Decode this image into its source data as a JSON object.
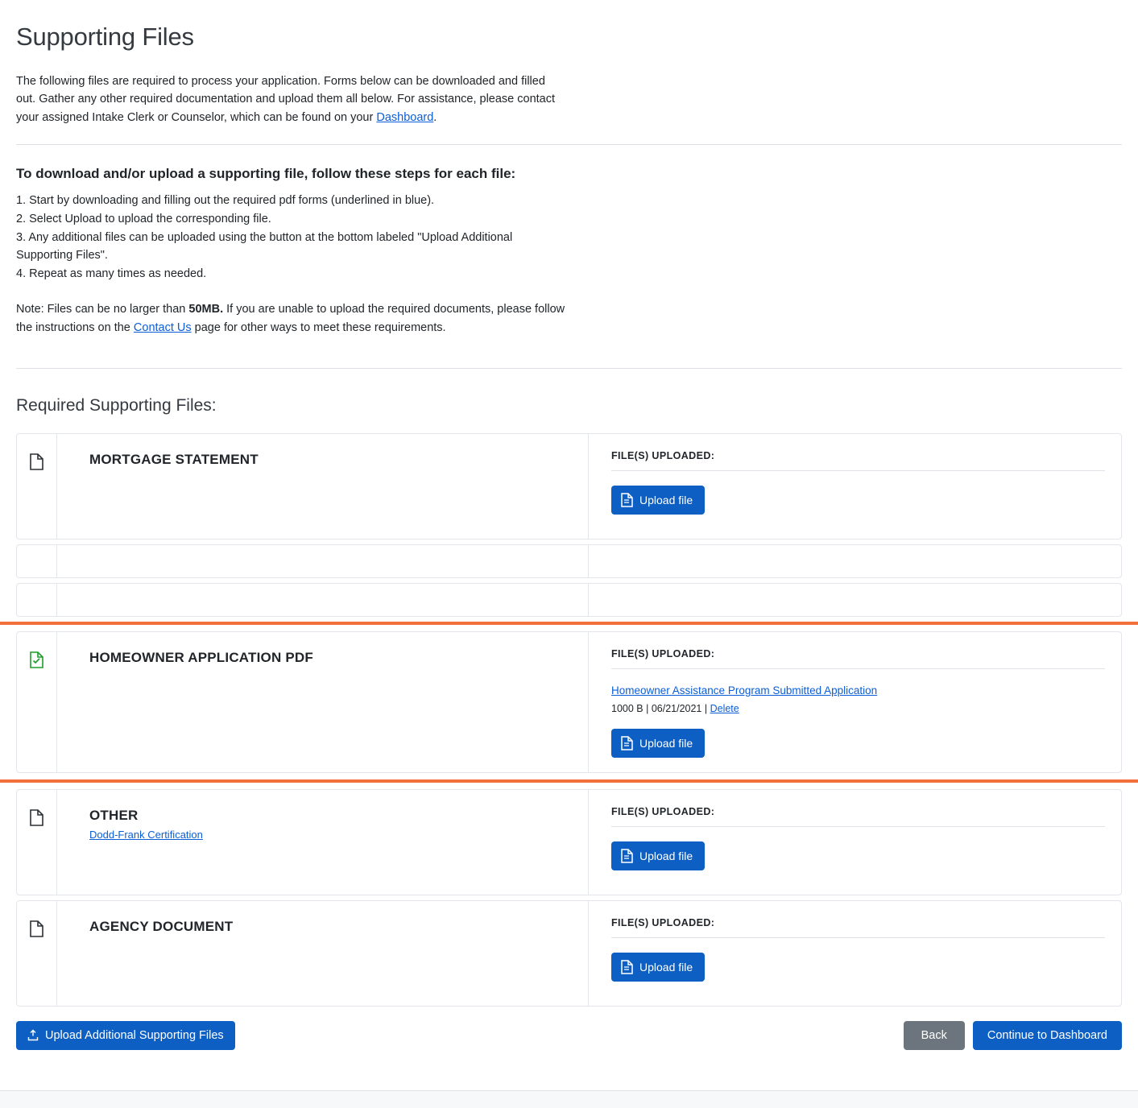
{
  "page": {
    "title": "Supporting Files",
    "intro_before_link": "The following files are required to process your application. Forms below can be downloaded and filled out. Gather any other required documentation and upload them all below. For assistance, please contact your assigned Intake Clerk or Counselor, which can be found on your ",
    "intro_link": "Dashboard",
    "intro_after_link": "."
  },
  "steps": {
    "heading": "To download and/or upload a supporting file, follow these steps for each file:",
    "items": [
      "1. Start by downloading and filling out the required pdf forms (underlined in blue).",
      "2. Select Upload to upload the corresponding file.",
      "3. Any additional files can be uploaded using the button at the bottom labeled \"Upload Additional Supporting Files\".",
      "4. Repeat as many times as needed."
    ],
    "note_before_bold": "Note: Files can be no larger than ",
    "note_bold": "50MB.",
    "note_after_bold": " If you are unable to upload the required documents, please follow the instructions on the ",
    "note_link": "Contact Us",
    "note_end": " page for other ways to meet these requirements."
  },
  "section": {
    "heading": "Required Supporting Files:"
  },
  "labels": {
    "files_uploaded": "FILE(S) UPLOADED:",
    "upload_file": "Upload file",
    "delete": "Delete",
    "separator": " | "
  },
  "cards": [
    {
      "name": "MORTGAGE STATEMENT",
      "sublink": "",
      "icon": "document-icon",
      "status": "empty",
      "highlighted": false,
      "files": []
    },
    {
      "name": "",
      "sublink": "",
      "icon": "document-icon",
      "status": "empty",
      "highlighted": false,
      "sliver": true,
      "files": []
    },
    {
      "name": "",
      "sublink": "",
      "icon": "document-icon",
      "status": "empty",
      "highlighted": false,
      "sliver": true,
      "files": []
    },
    {
      "name": "HOMEOWNER APPLICATION PDF",
      "sublink": "",
      "icon": "document-check-icon",
      "status": "uploaded",
      "highlighted": true,
      "files": [
        {
          "name": "Homeowner Assistance Program Submitted Application",
          "size": "1000 B",
          "date": "06/21/2021",
          "delete_label": "Delete"
        }
      ]
    },
    {
      "name": "OTHER",
      "sublink": "Dodd-Frank Certification",
      "icon": "document-icon",
      "status": "empty",
      "highlighted": false,
      "files": []
    },
    {
      "name": "AGENCY DOCUMENT",
      "sublink": "",
      "icon": "document-icon",
      "status": "empty",
      "highlighted": false,
      "files": []
    }
  ],
  "footer": {
    "upload_additional": "Upload Additional Supporting Files",
    "back": "Back",
    "continue": "Continue to Dashboard"
  },
  "colors": {
    "primary_blue": "#0d5fc3",
    "link_blue": "#0b5ed7",
    "highlight_orange": "#f2703c",
    "gray_button": "#6c757d",
    "success_green": "#1f9d2b"
  }
}
